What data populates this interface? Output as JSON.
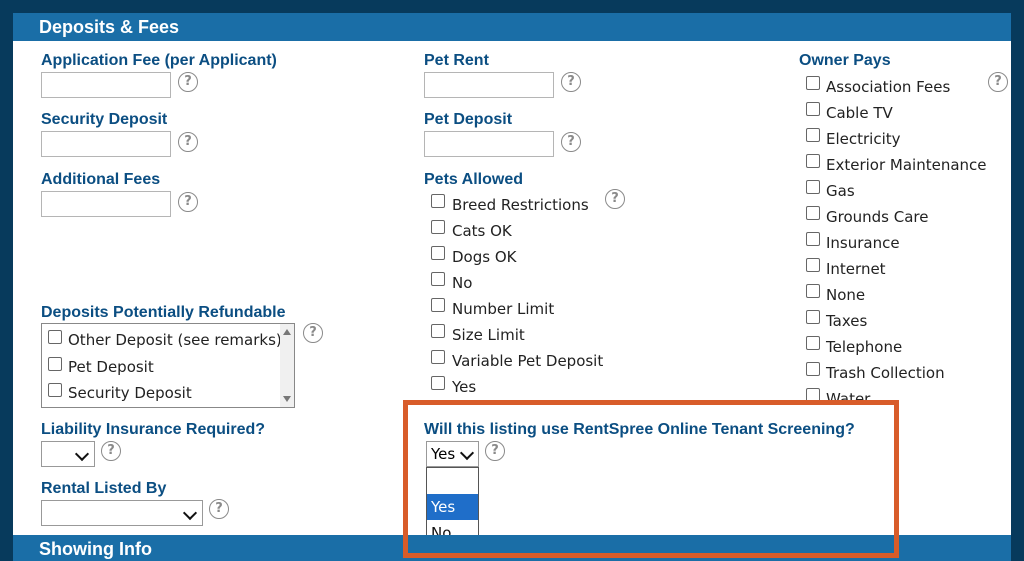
{
  "header": {
    "title": "Deposits & Fees"
  },
  "fees": {
    "application_fee_label": "Application Fee (per Applicant)",
    "security_deposit_label": "Security Deposit",
    "additional_fees_label": "Additional Fees",
    "pet_rent_label": "Pet Rent",
    "pet_deposit_label": "Pet Deposit"
  },
  "pets": {
    "label": "Pets Allowed",
    "options": [
      "Breed Restrictions",
      "Cats OK",
      "Dogs OK",
      "No",
      "Number Limit",
      "Size Limit",
      "Variable Pet Deposit",
      "Yes"
    ]
  },
  "owner_pays": {
    "label": "Owner Pays",
    "options": [
      "Association Fees",
      "Cable TV",
      "Electricity",
      "Exterior Maintenance",
      "Gas",
      "Grounds Care",
      "Insurance",
      "Internet",
      "None",
      "Taxes",
      "Telephone",
      "Trash Collection",
      "Water"
    ]
  },
  "refundable": {
    "label": "Deposits Potentially Refundable",
    "options": [
      "Other Deposit (see remarks)",
      "Pet Deposit",
      "Security Deposit"
    ]
  },
  "liability": {
    "label": "Liability Insurance Required?",
    "value": ""
  },
  "listed_by": {
    "label": "Rental Listed By",
    "value": ""
  },
  "screening": {
    "label": "Will this listing use RentSpree Online Tenant Screening?",
    "value": "Yes",
    "options": [
      "",
      "Yes",
      "No"
    ]
  },
  "showing": {
    "title": "Showing Info"
  },
  "help_glyph": "?",
  "colors": {
    "section_bar": "#1a6ea7",
    "label": "#0b4e82",
    "highlight": "#d85c2a",
    "selected_option": "#1f6ec9",
    "background": "#073a5c"
  }
}
